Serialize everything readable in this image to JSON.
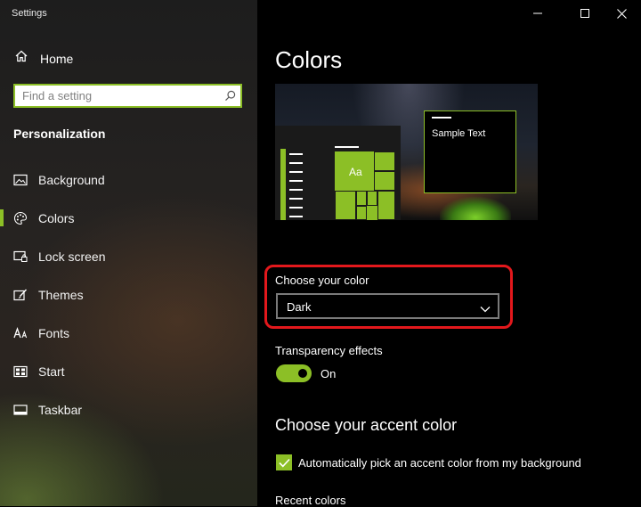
{
  "app": {
    "title": "Settings"
  },
  "window_controls": {
    "minimize": "minimize-icon",
    "maximize": "maximize-icon",
    "close": "close-icon"
  },
  "sidebar": {
    "home_label": "Home",
    "home_icon": "home-icon",
    "search": {
      "placeholder": "Find a setting",
      "value": "",
      "icon": "search-icon"
    },
    "section_title": "Personalization",
    "items": [
      {
        "label": "Background",
        "icon": "background-image-icon",
        "active": false
      },
      {
        "label": "Colors",
        "icon": "palette-icon",
        "active": true
      },
      {
        "label": "Lock screen",
        "icon": "lock-screen-icon",
        "active": false
      },
      {
        "label": "Themes",
        "icon": "themes-brush-icon",
        "active": false
      },
      {
        "label": "Fonts",
        "icon": "fonts-icon",
        "active": false
      },
      {
        "label": "Start",
        "icon": "start-menu-icon",
        "active": false
      },
      {
        "label": "Taskbar",
        "icon": "taskbar-icon",
        "active": false
      }
    ]
  },
  "main": {
    "title": "Colors",
    "preview": {
      "tile_text": "Aa",
      "window_text": "Sample Text"
    },
    "choose_color": {
      "label": "Choose your color",
      "value": "Dark"
    },
    "transparency": {
      "label": "Transparency effects",
      "state": "On",
      "enabled": true
    },
    "accent": {
      "title": "Choose your accent color",
      "auto_pick_label": "Automatically pick an accent color from my background",
      "auto_pick_checked": true,
      "recent_colors_label": "Recent colors"
    }
  },
  "colors": {
    "accent": "#8cbf26",
    "highlight": "#e3181c",
    "background": "#000000"
  }
}
